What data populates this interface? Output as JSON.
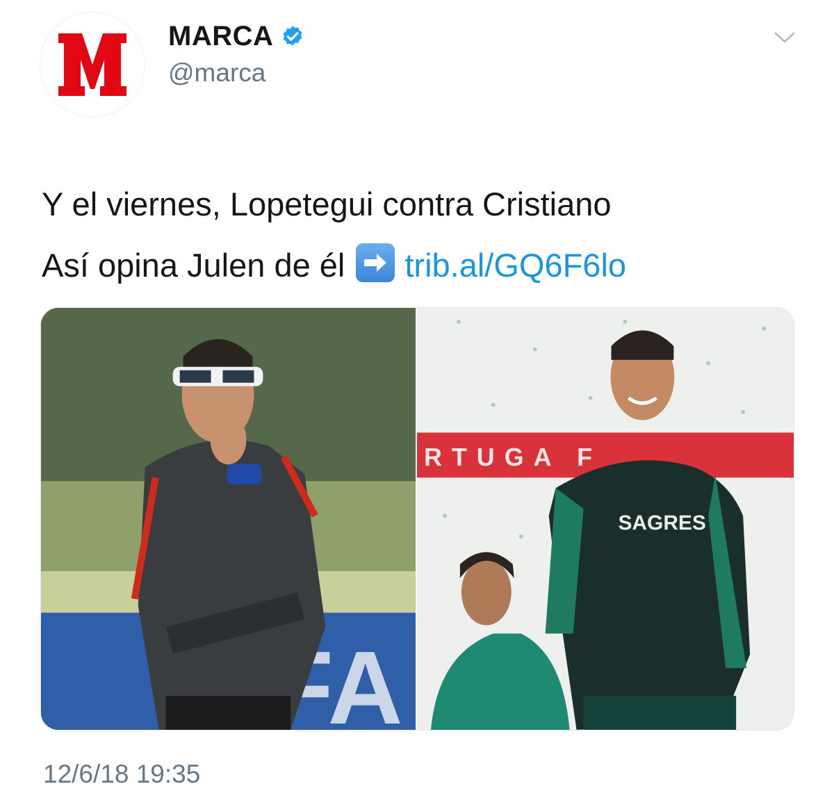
{
  "tweet": {
    "author": {
      "display_name": "MARCA",
      "handle": "@marca",
      "avatar_letter": "M",
      "verified": true,
      "verified_icon": "verified-badge-icon"
    },
    "menu_icon": "chevron-down-icon",
    "text_line1": "Y el viernes, Lopetegui contra Cristiano",
    "text_line2_prefix": "Así opina Julen de él",
    "arrow_emoji_icon": "right-arrow-emoji-icon",
    "link_text": "trib.al/GQ6F6lo",
    "media": {
      "left_photo": {
        "shirt_text": ""
      },
      "right_photo": {
        "banner_text": "RTUGA                F",
        "shirt_sponsor": "SAGRES"
      }
    },
    "timestamp": "12/6/18 19:35"
  },
  "colors": {
    "brand_red": "#e30613",
    "link_blue": "#1b95e0",
    "verified_blue": "#1da1f2",
    "secondary_text": "#657786"
  }
}
